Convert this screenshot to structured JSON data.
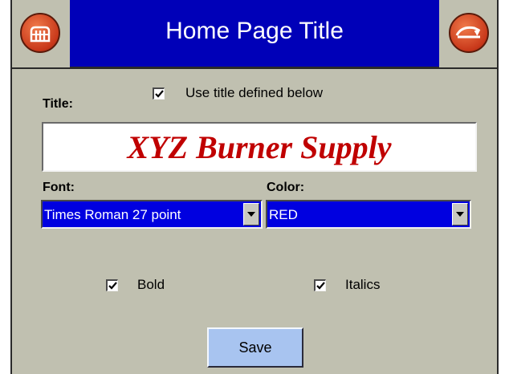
{
  "header": {
    "title": "Home Page Title",
    "left_button_icon": "home-icon",
    "right_button_icon": "exit-icon"
  },
  "use_title": {
    "label": "Use title defined below",
    "checked": true
  },
  "title_field": {
    "label": "Title:",
    "value": "XYZ Burner Supply",
    "color": "#c00000"
  },
  "font": {
    "label": "Font:",
    "value": "Times Roman 27 point"
  },
  "color": {
    "label": "Color:",
    "value": "RED"
  },
  "bold": {
    "label": "Bold",
    "checked": true
  },
  "italics": {
    "label": "Italics",
    "checked": true
  },
  "save": {
    "label": "Save"
  },
  "colors": {
    "titlebar": "#0000b8",
    "panel": "#c0c0b0",
    "select_bg": "#0000e0",
    "save_bg": "#a8c4f0"
  }
}
